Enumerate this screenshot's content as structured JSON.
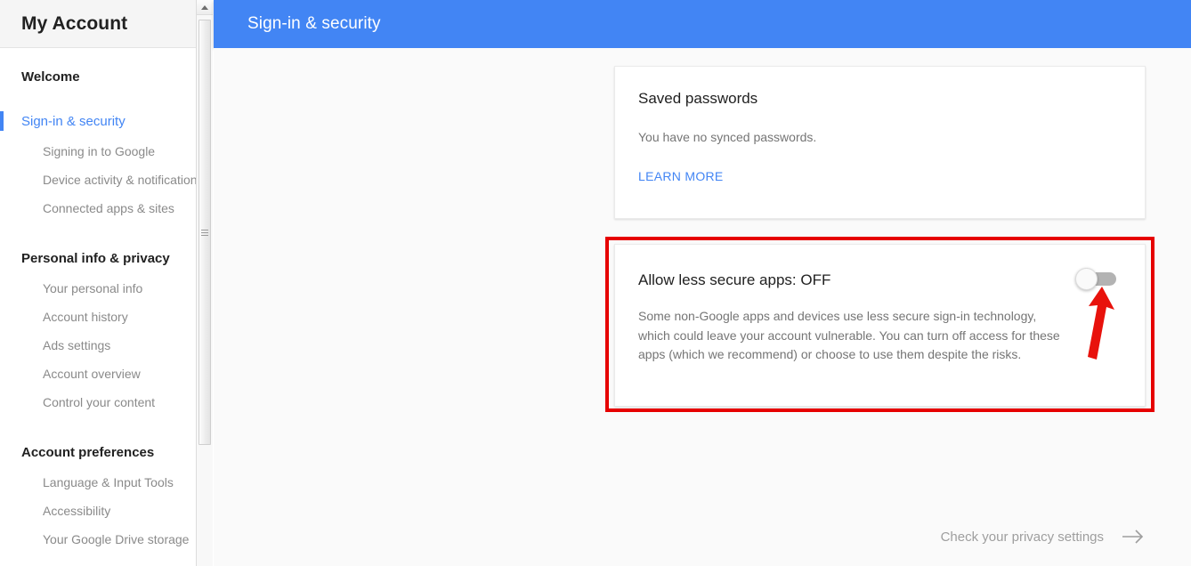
{
  "colors": {
    "accent_blue": "#4285f4",
    "highlight_red": "#e60000",
    "page_bg": "#fafafa",
    "muted_text": "#757575"
  },
  "sidebar": {
    "header_title": "My Account",
    "groups": [
      {
        "top": {
          "label": "Welcome",
          "active": false
        },
        "children": []
      },
      {
        "top": {
          "label": "Sign-in & security",
          "active": true
        },
        "children": [
          {
            "label": "Signing in to Google"
          },
          {
            "label": "Device activity & notifications"
          },
          {
            "label": "Connected apps & sites"
          }
        ]
      },
      {
        "top": {
          "label": "Personal info & privacy",
          "active": false
        },
        "children": [
          {
            "label": "Your personal info"
          },
          {
            "label": "Account history"
          },
          {
            "label": "Ads settings"
          },
          {
            "label": "Account overview"
          },
          {
            "label": "Control your content"
          }
        ]
      },
      {
        "top": {
          "label": "Account preferences",
          "active": false
        },
        "children": [
          {
            "label": "Language & Input Tools"
          },
          {
            "label": "Accessibility"
          },
          {
            "label": "Your Google Drive storage"
          }
        ]
      }
    ]
  },
  "header": {
    "page_title": "Sign-in & security"
  },
  "cards": {
    "saved_passwords": {
      "title": "Saved passwords",
      "body": "You have no synced passwords.",
      "link_label": "LEARN MORE"
    },
    "less_secure_apps": {
      "title": "Allow less secure apps: OFF",
      "toggle_state": "OFF",
      "description": "Some non-Google apps and devices use less secure sign-in technology, which could leave your account vulnerable. You can turn off access for these apps (which we recommend) or choose to use them despite the risks."
    }
  },
  "footer": {
    "privacy_link_label": "Check your privacy settings"
  }
}
